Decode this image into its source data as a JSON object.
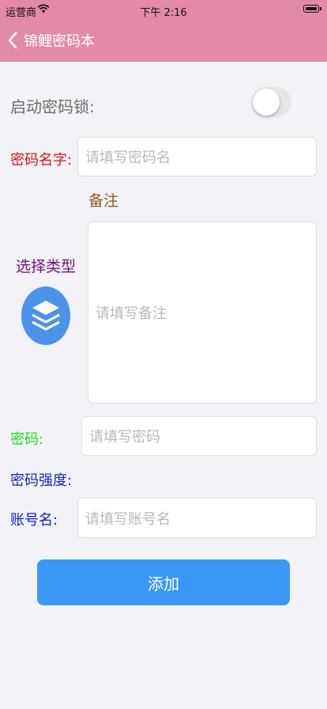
{
  "status_bar": {
    "carrier": "运营商",
    "time": "下午 2:16"
  },
  "nav": {
    "title": "锦鲤密码本"
  },
  "lock": {
    "label": "启动密码锁:",
    "enabled": false
  },
  "name_field": {
    "label": "密码名字:",
    "placeholder": "请填写密码名"
  },
  "note": {
    "label": "备注",
    "placeholder": "请填写备注"
  },
  "type": {
    "label": "选择类型",
    "icon": "layers-icon"
  },
  "password_field": {
    "label": "密码:",
    "placeholder": "请填写密码"
  },
  "strength": {
    "label": "密码强度:"
  },
  "account_field": {
    "label": "账号名:",
    "placeholder": "请填写账号名"
  },
  "submit": {
    "label": "添加"
  },
  "colors": {
    "nav_bg": "#e38aa8",
    "page_bg": "#f2f2f7",
    "button_bg": "#3a98f5",
    "name_label": "#e0101b",
    "note_label": "#8a5a22",
    "type_label": "#76107c",
    "password_label": "#1de11b",
    "strength_label": "#1228b8",
    "account_label": "#0f1bd8"
  }
}
